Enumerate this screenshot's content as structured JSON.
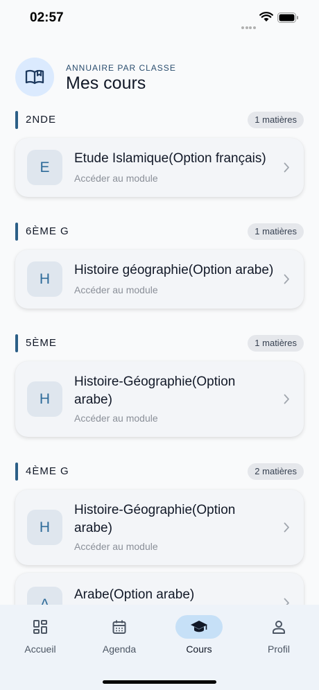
{
  "status_bar": {
    "time": "02:57"
  },
  "header": {
    "overline": "ANNUAIRE PAR CLASSE",
    "title": "Mes cours",
    "icon": "open-book-icon"
  },
  "sections": [
    {
      "label": "2NDE",
      "count": "1 matières",
      "courses": [
        {
          "letter": "E",
          "title": "Etude Islamique(Option français)",
          "subtitle": "Accéder au module"
        }
      ]
    },
    {
      "label": "6ÈME G",
      "count": "1 matières",
      "courses": [
        {
          "letter": "H",
          "title": "Histoire géographie(Option arabe)",
          "subtitle": "Accéder au module"
        }
      ]
    },
    {
      "label": "5ÈME",
      "count": "1 matières",
      "courses": [
        {
          "letter": "H",
          "title": "Histoire-Géographie(Option arabe)",
          "subtitle": "Accéder au module"
        }
      ]
    },
    {
      "label": "4ÈME G",
      "count": "2 matières",
      "courses": [
        {
          "letter": "H",
          "title": "Histoire-Géographie(Option arabe)",
          "subtitle": "Accéder au module"
        },
        {
          "letter": "A",
          "title": "Arabe(Option arabe)",
          "subtitle": ""
        }
      ]
    }
  ],
  "bottom_nav": {
    "items": [
      {
        "label": "Accueil",
        "icon": "dashboard-icon"
      },
      {
        "label": "Agenda",
        "icon": "calendar-icon"
      },
      {
        "label": "Cours",
        "icon": "graduation-cap-icon",
        "active": true
      },
      {
        "label": "Profil",
        "icon": "person-icon"
      }
    ]
  },
  "colors": {
    "accent": "#2c5f87",
    "avatar_bg": "#dfe6ee",
    "nav_active_bg": "#c6e0f7"
  }
}
